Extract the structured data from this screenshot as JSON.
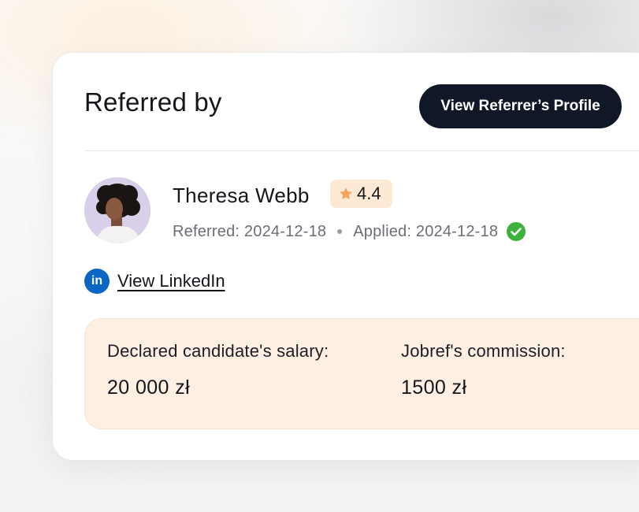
{
  "card": {
    "title": "Referred by",
    "view_profile_label": "View Referrer’s Profile"
  },
  "referrer": {
    "name": "Theresa Webb",
    "rating": "4.4",
    "referred_text": "Referred: 2024-12-18",
    "applied_text": "Applied: 2024-12-18",
    "linkedin_label": "View LinkedIn",
    "linkedin_icon_text": "in"
  },
  "compensation": {
    "salary_label": "Declared candidate's salary:",
    "salary_value": "20 000 zł",
    "commission_label": "Jobref's commission:",
    "commission_value": "1500 zł"
  },
  "icons": {
    "rating": "star-icon",
    "applied_status": "check-circle-icon",
    "linkedin": "linkedin-icon"
  },
  "colors": {
    "button_bg": "#101828",
    "rating_bg": "#fde9d4",
    "star": "#f5a45c",
    "check": "#3cb13c",
    "linkedin": "#0a66c2",
    "salary_box_bg": "#fdf0e3"
  }
}
